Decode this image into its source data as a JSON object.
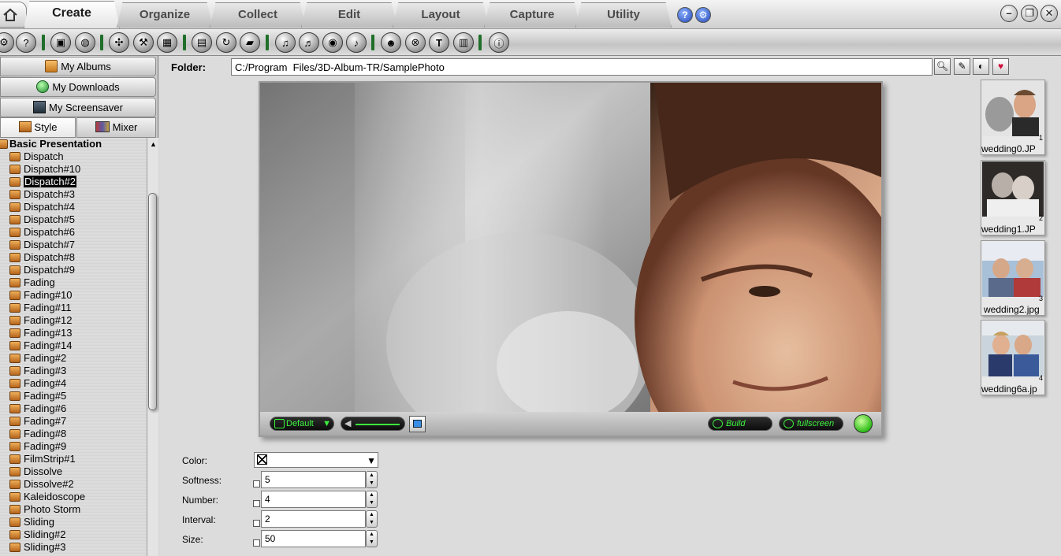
{
  "tabs": [
    {
      "label": "Create",
      "active": true
    },
    {
      "label": "Organize",
      "active": false
    },
    {
      "label": "Collect",
      "active": false
    },
    {
      "label": "Edit",
      "active": false
    },
    {
      "label": "Layout",
      "active": false
    },
    {
      "label": "Capture",
      "active": false
    },
    {
      "label": "Utility",
      "active": false
    }
  ],
  "left_buttons": [
    {
      "label": "My Albums",
      "icon": "folder-icon"
    },
    {
      "label": "My Downloads",
      "icon": "globe-icon"
    },
    {
      "label": "My Screensaver",
      "icon": "computer-icon"
    }
  ],
  "subtabs": [
    {
      "label": "Style",
      "icon": "box-icon",
      "active": true
    },
    {
      "label": "Mixer",
      "icon": "books-icon",
      "active": false
    }
  ],
  "tree": {
    "root": "Basic Presentation",
    "items": [
      "Dispatch",
      "Dispatch#10",
      "Dispatch#2",
      "Dispatch#3",
      "Dispatch#4",
      "Dispatch#5",
      "Dispatch#6",
      "Dispatch#7",
      "Dispatch#8",
      "Dispatch#9",
      "Fading",
      "Fading#10",
      "Fading#11",
      "Fading#12",
      "Fading#13",
      "Fading#14",
      "Fading#2",
      "Fading#3",
      "Fading#4",
      "Fading#5",
      "Fading#6",
      "Fading#7",
      "Fading#8",
      "Fading#9",
      "FilmStrip#1",
      "Dissolve",
      "Dissolve#2",
      "Kaleidoscope",
      "Photo Storm",
      "Sliding",
      "Sliding#2",
      "Sliding#3"
    ],
    "selected": "Dispatch#2"
  },
  "folder": {
    "label": "Folder:",
    "value": "C:/Program  Files/3D-Album-TR/SamplePhoto"
  },
  "player": {
    "default_label": "Default",
    "build_label": "Build",
    "fullscreen_label": "fullscreen"
  },
  "thumbnails": [
    {
      "name": "wedding0.JP",
      "num": "1"
    },
    {
      "name": "wedding1.JP",
      "num": "2"
    },
    {
      "name": "wedding2.jpg",
      "num": "3"
    },
    {
      "name": "wedding6a.jp",
      "num": "4"
    }
  ],
  "properties": {
    "color_label": "Color:",
    "softness_label": "Softness:",
    "softness": "5",
    "number_label": "Number:",
    "number": "4",
    "interval_label": "Interval:",
    "interval": "2",
    "size_label": "Size:",
    "size": "50"
  },
  "colors": {
    "accent_green": "#1f6f2a",
    "led_green": "#3cf23c",
    "selection": "#000000"
  }
}
